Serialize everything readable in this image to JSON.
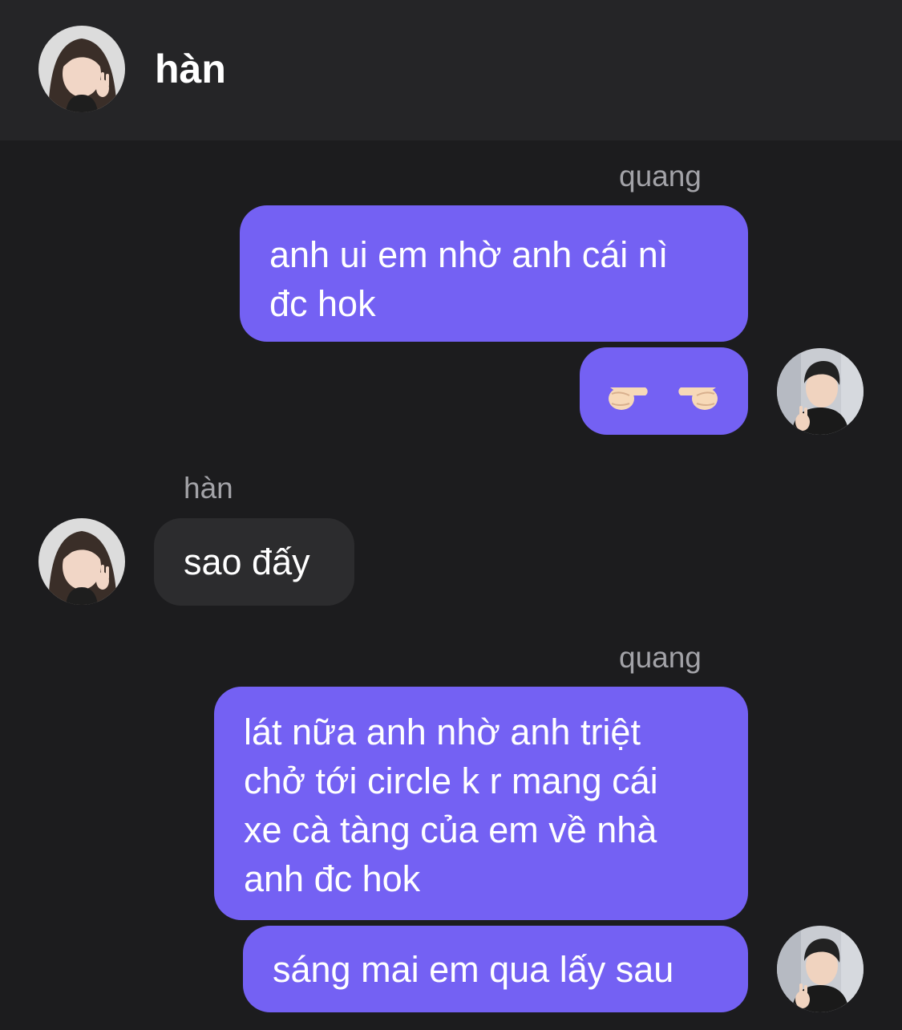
{
  "header": {
    "title": "hàn",
    "avatar": "profile-photo-han"
  },
  "messages": [
    {
      "sender_label": "quang",
      "direction": "outgoing",
      "bubbles": [
        {
          "lines": [
            "anh ui em nhờ anh cái nì",
            "đc hok"
          ]
        },
        {
          "emoji": "👉👈"
        }
      ],
      "avatar": "profile-photo-quang"
    },
    {
      "sender_label": "hàn",
      "direction": "incoming",
      "bubbles": [
        {
          "lines": [
            "sao đấy"
          ]
        }
      ],
      "avatar": "profile-photo-han"
    },
    {
      "sender_label": "quang",
      "direction": "outgoing",
      "bubbles": [
        {
          "lines": [
            "lát nữa anh nhờ anh triệt",
            "chở tới circle k r mang cái",
            "xe cà tàng của em về nhà",
            "anh đc hok"
          ]
        },
        {
          "lines": [
            "sáng mai em qua lấy sau"
          ]
        }
      ],
      "avatar": "profile-photo-quang"
    }
  ],
  "colors": {
    "background": "#1c1c1e",
    "header": "#252527",
    "outgoing_bubble": "#7461f3",
    "incoming_bubble": "#2c2c2e",
    "sender_label": "#a3a3a8"
  }
}
